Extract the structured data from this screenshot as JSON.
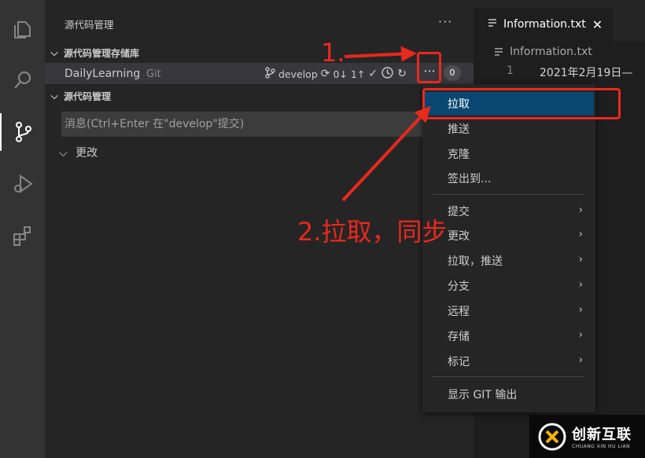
{
  "sidebar": {
    "title": "源代码管理",
    "more": "···",
    "repositories_header": "源代码管理存储库",
    "repo": {
      "name": "DailyLearning",
      "type": "Git",
      "branch": "develop",
      "sync_status": "0↓ 1↑",
      "more": "···",
      "badge_count": "0"
    },
    "scm_header": "源代码管理",
    "commit_placeholder": "消息(Ctrl+Enter 在\"develop\"提交)",
    "changes_label": "更改"
  },
  "editor": {
    "tab_label": "Information.txt",
    "breadcrumb": "Information.txt",
    "line_number": "1",
    "line_text": "2021年2月19日—"
  },
  "context_menu": {
    "items": [
      {
        "label": "拉取",
        "submenu": false
      },
      {
        "label": "推送",
        "submenu": false
      },
      {
        "label": "克隆",
        "submenu": false
      },
      {
        "label": "签出到...",
        "submenu": false
      },
      {
        "label": "提交",
        "submenu": true
      },
      {
        "label": "更改",
        "submenu": true
      },
      {
        "label": "拉取，推送",
        "submenu": true
      },
      {
        "label": "分支",
        "submenu": true
      },
      {
        "label": "远程",
        "submenu": true
      },
      {
        "label": "存储",
        "submenu": true
      },
      {
        "label": "标记",
        "submenu": true
      },
      {
        "label": "显示 GIT 输出",
        "submenu": false
      }
    ],
    "highlighted": "拉取"
  },
  "annotations": {
    "step1": "1.",
    "step2": "2.拉取，同步",
    "color": "#e8291c"
  },
  "watermark": {
    "text_cn": "创新互联",
    "text_en": "CHUANG XIN HU LIAN"
  },
  "icons": {
    "activity_bar": [
      "explorer-icon",
      "search-icon",
      "source-control-icon",
      "run-debug-icon",
      "extensions-icon"
    ],
    "repo_actions": [
      "branch-icon",
      "sync-icon",
      "commit-check-icon",
      "history-icon",
      "refresh-icon"
    ]
  },
  "colors": {
    "accent": "#094771",
    "activity_bar": "#333333",
    "sidebar": "#252526",
    "editor": "#1e1e1e"
  }
}
